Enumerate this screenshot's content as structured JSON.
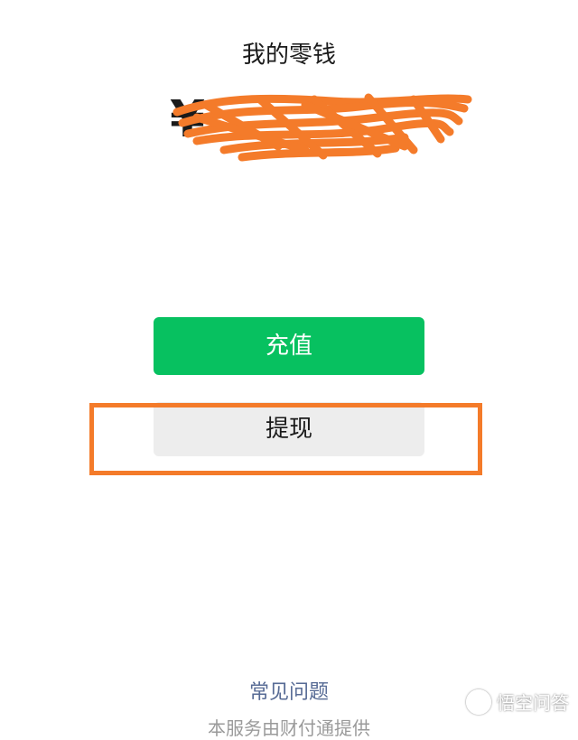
{
  "page": {
    "title": "我的零钱"
  },
  "balance": {
    "currency_symbol": "¥",
    "redaction_color": "#f47b2a"
  },
  "actions": {
    "recharge_label": "充值",
    "withdraw_label": "提现"
  },
  "links": {
    "faq_label": "常见问题"
  },
  "footer": {
    "provider_text": "本服务由财付通提供"
  },
  "watermark": {
    "text": "悟空问答"
  },
  "colors": {
    "primary_green": "#07c160",
    "secondary_gray": "#ededed",
    "link_blue": "#576b95",
    "highlight_orange": "#f47b2a"
  }
}
